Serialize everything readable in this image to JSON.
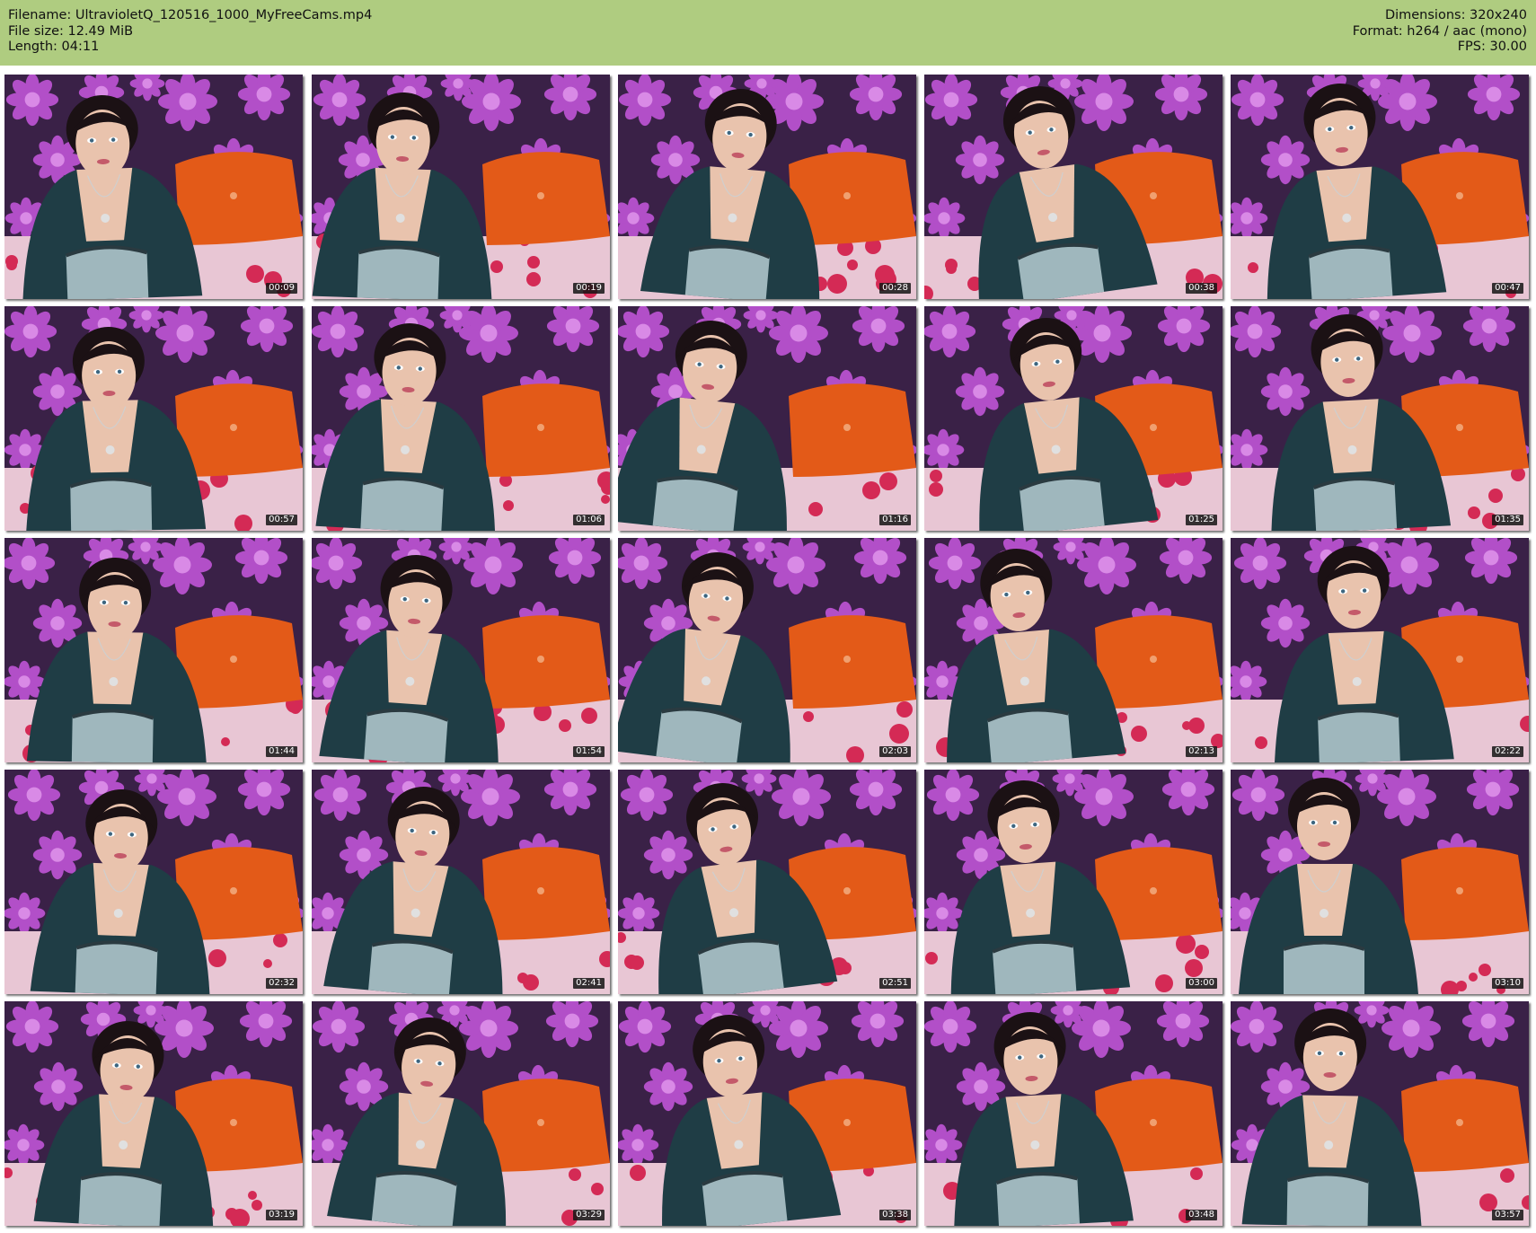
{
  "header": {
    "left_lines": [
      "Filename: UltravioletQ_120516_1000_MyFreeCams.mp4",
      "File size: 12.49 MiB",
      "Length: 04:11"
    ],
    "right_lines": [
      "Dimensions: 320x240",
      "Format: h264 / aac (mono)",
      "FPS: 30.00"
    ]
  },
  "thumbnails": [
    {
      "timestamp": "00:09"
    },
    {
      "timestamp": "00:19"
    },
    {
      "timestamp": "00:28"
    },
    {
      "timestamp": "00:38"
    },
    {
      "timestamp": "00:47"
    },
    {
      "timestamp": "00:57"
    },
    {
      "timestamp": "01:06"
    },
    {
      "timestamp": "01:16"
    },
    {
      "timestamp": "01:25"
    },
    {
      "timestamp": "01:35"
    },
    {
      "timestamp": "01:44"
    },
    {
      "timestamp": "01:54"
    },
    {
      "timestamp": "02:03"
    },
    {
      "timestamp": "02:13"
    },
    {
      "timestamp": "02:22"
    },
    {
      "timestamp": "02:32"
    },
    {
      "timestamp": "02:41"
    },
    {
      "timestamp": "02:51"
    },
    {
      "timestamp": "03:00"
    },
    {
      "timestamp": "03:10"
    },
    {
      "timestamp": "03:19"
    },
    {
      "timestamp": "03:29"
    },
    {
      "timestamp": "03:38"
    },
    {
      "timestamp": "03:48"
    },
    {
      "timestamp": "03:57"
    }
  ],
  "colors": {
    "header_bg": "#afcc80",
    "wallpaper_bg": "#3a2147",
    "flower": "#b24fc8",
    "pillow": "#e35a18",
    "cardigan": "#1f3d45",
    "skin": "#e9c3ad",
    "hair": "#1b1114",
    "blanket": "#e8c6d4",
    "blanket_flower": "#d42a55"
  }
}
